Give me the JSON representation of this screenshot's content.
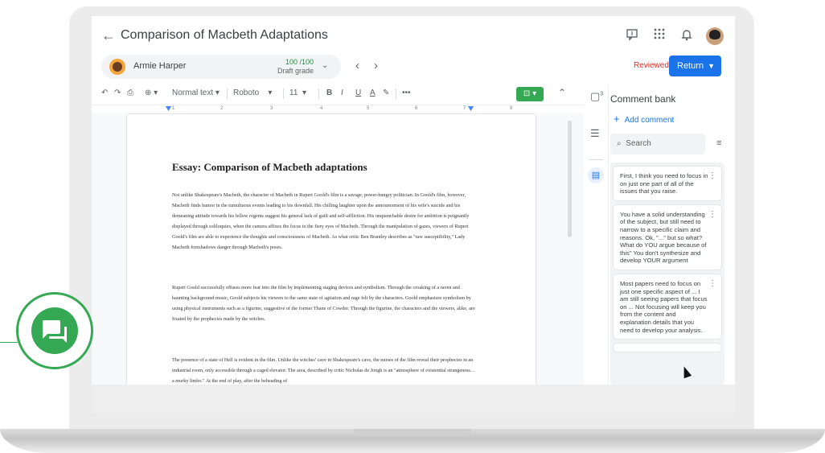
{
  "header": {
    "back_icon": "arrow-back-icon",
    "title": "Comparison of Macbeth Adaptations",
    "icons": [
      "comment-icon",
      "apps-grid-icon",
      "bell-icon",
      "user-avatar"
    ]
  },
  "student": {
    "name": "Armie Harper",
    "grade": "100 /100",
    "grade_status": "Draft grade",
    "prev_label": "‹",
    "next_label": "›"
  },
  "status": {
    "reviewed": "Reviewed",
    "return_label": "Return"
  },
  "toolbar": {
    "style": "Normal text",
    "font": "Roboto",
    "size": "11",
    "bold": "B",
    "italic": "I",
    "underline": "U",
    "text_color": "A",
    "more": "•••"
  },
  "ruler": {
    "numbers": [
      "1",
      "2",
      "3",
      "4",
      "5",
      "6",
      "7",
      "8"
    ]
  },
  "document": {
    "title": "Essay: Comparison of Macbeth adaptations",
    "paragraphs": [
      "Not unlike Shakespeare's Macbeth, the character of Macbeth in Rupert Goold's film is a savage, power-hungry politician. In Goold's film, however, Macbeth finds humor in the tumultuous events leading to his downfall. His chilling laughter upon the announcement of his wife's suicide and his demeaning attitude towards his fellow regents suggest his general lack of guilt and self-affliction. His unquenchable desire for ambition is poignantly displayed through soliloquies, when the camera affixes the focus to the fiery eyes of Macbeth. Through the manipulation of gazes, viewers of Rupert Goold's film are able to experience the thoughts and consciousness of Macbeth. As what critic Ben Brantley describes as \"raw susceptibility,\" Lady Macbeth foreshadows danger through Macbeth's poses.",
      "Rupert Goold successfully effuses more fear into the film by implementing staging devices and symbolism. Through the croaking of a raven and haunting background music, Goold subjects his viewers to the same state of agitation and rage felt by the characters. Goold emphasizes symbolism by using physical instruments such as a figurine, suggestive of the former Thane of Cowder. Through the figurine, the characters and the viewers, alike, are fixated by the prophecies made by the witches.",
      "The presence of a state of Hell is evident in the film. Unlike the witches' cave in Shakespeare's cave, the nurses of the film reveal their prophecies in an industrial room, only accessible through a caged elevator. The area, described by critic Nicholas de Jongh is an \"atmosphere of existential strangeness… a murky limbo.\" At the end of play, after the beheading of"
    ]
  },
  "side": {
    "badge": "3"
  },
  "comment_bank": {
    "title": "Comment bank",
    "add_label": "Add comment",
    "search_placeholder": "Search",
    "comments": [
      "First, I think you need to focus in on just one part of all of the issues that you raise.",
      "You have a solid understanding of the subject, but still need to narrow to a specific claim and reasons. Ok, \"...\" but so what? What do YOU argue because of this\" You don't synthesize and develop YOUR argument",
      "Most papers need to focus on just one specific aspect of ... I am still seeing papers that focus on ... Not focusing will keep you from the content and explanation details that you need to develop your analysis."
    ]
  },
  "colors": {
    "accent": "#1a73e8",
    "green": "#34a853",
    "reviewed": "#d93025"
  }
}
